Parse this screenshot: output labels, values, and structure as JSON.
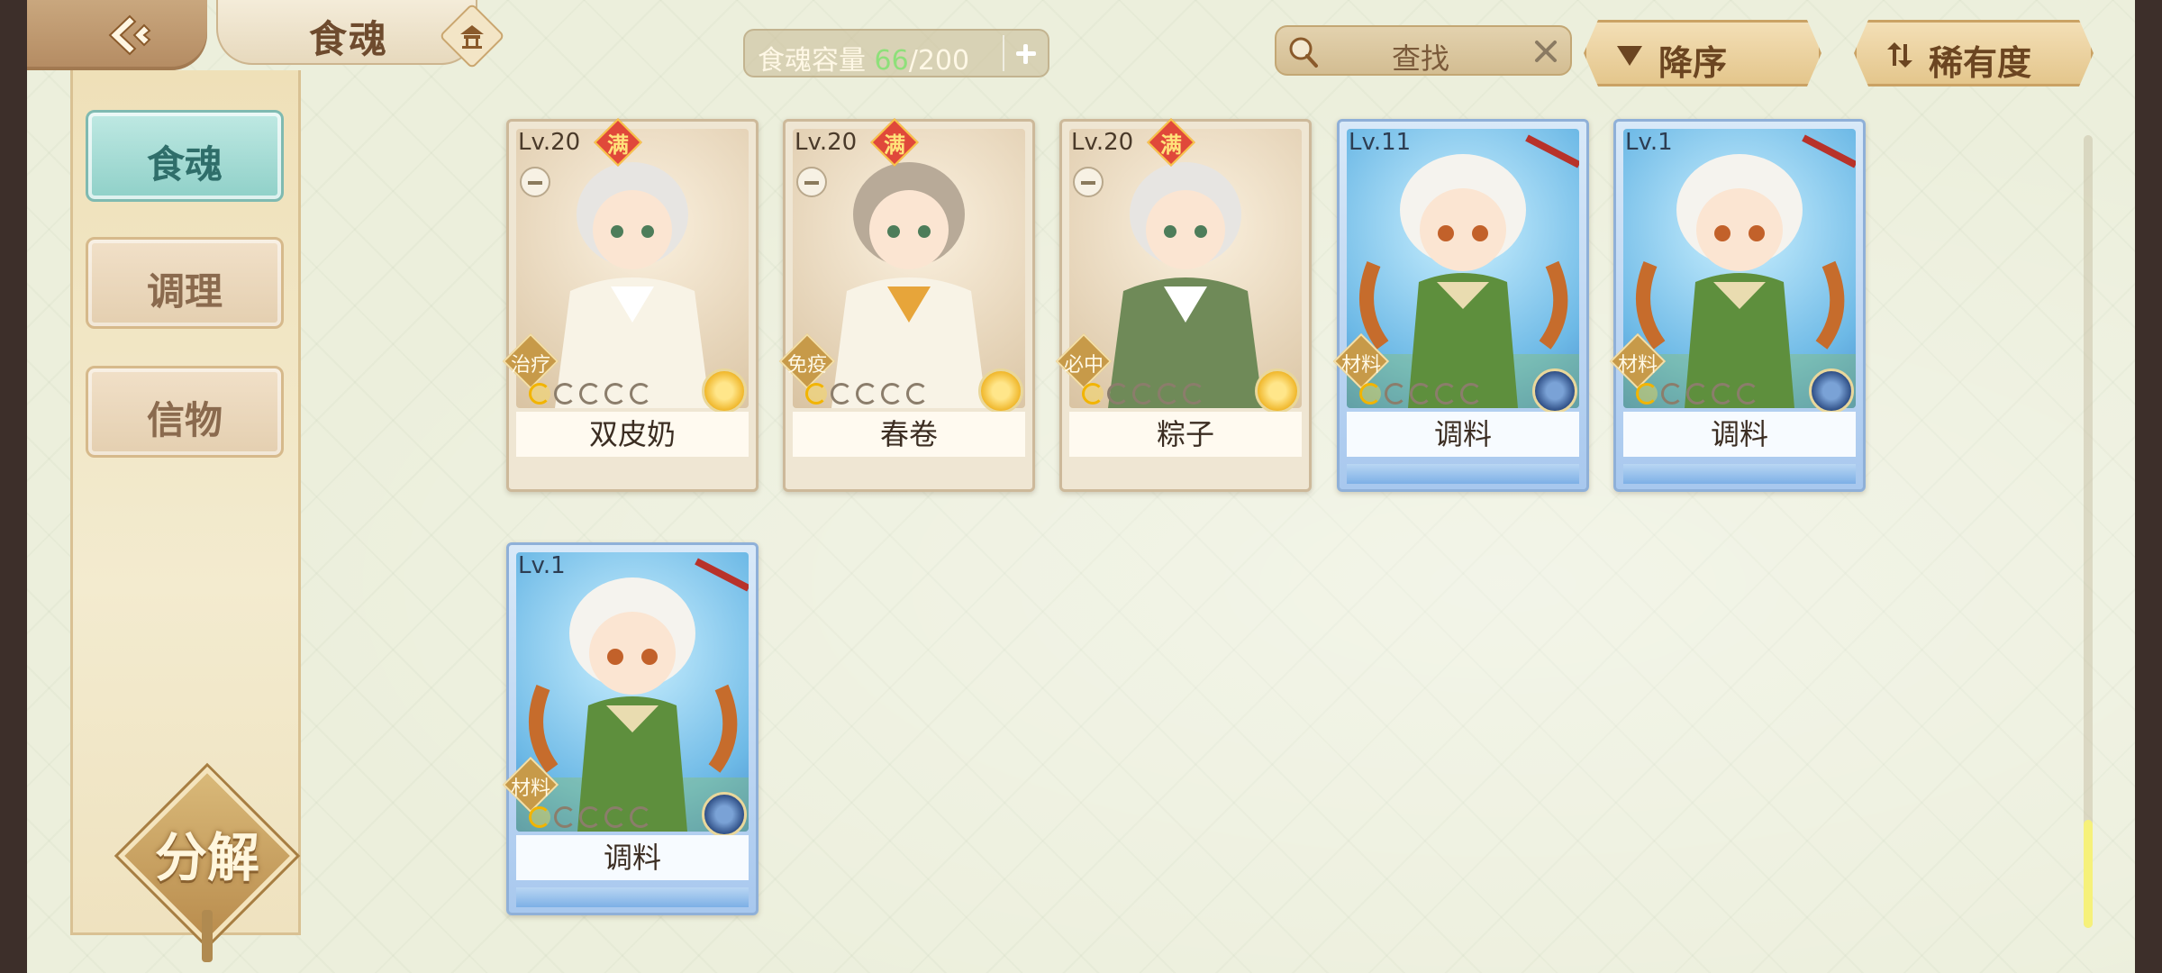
{
  "header": {
    "title": "食魂",
    "capacity": {
      "label": "食魂容量",
      "current": "66",
      "separator": "/",
      "max": "200"
    },
    "search": {
      "text": "查找"
    },
    "sort_order": {
      "label": "降序"
    },
    "sort_by": {
      "label": "稀有度"
    }
  },
  "sidebar": {
    "tabs": [
      {
        "label": "食魂",
        "active": true
      },
      {
        "label": "调理",
        "active": false
      },
      {
        "label": "信物",
        "active": false
      }
    ],
    "decompose": {
      "label": "分解"
    }
  },
  "cards": [
    {
      "level": "Lv.20",
      "max_badge": "满",
      "role": "治疗",
      "name": "双皮奶",
      "stars_lit": 1,
      "stars_total": 5,
      "rarity": "gold"
    },
    {
      "level": "Lv.20",
      "max_badge": "满",
      "role": "免疫",
      "name": "春卷",
      "stars_lit": 1,
      "stars_total": 5,
      "rarity": "gold"
    },
    {
      "level": "Lv.20",
      "max_badge": "满",
      "role": "必中",
      "name": "粽子",
      "stars_lit": 1,
      "stars_total": 5,
      "rarity": "gold"
    },
    {
      "level": "Lv.11",
      "max_badge": "",
      "role": "材料",
      "name": "调料",
      "stars_lit": 1,
      "stars_total": 5,
      "rarity": "blue"
    },
    {
      "level": "Lv.1",
      "max_badge": "",
      "role": "材料",
      "name": "调料",
      "stars_lit": 1,
      "stars_total": 5,
      "rarity": "blue"
    },
    {
      "level": "Lv.1",
      "max_badge": "",
      "role": "材料",
      "name": "调料",
      "stars_lit": 1,
      "stars_total": 5,
      "rarity": "blue"
    }
  ],
  "colors": {
    "accent_green": "#8ee07a",
    "active_tab": "#8fd0c8",
    "max_badge": "#e0483a"
  }
}
